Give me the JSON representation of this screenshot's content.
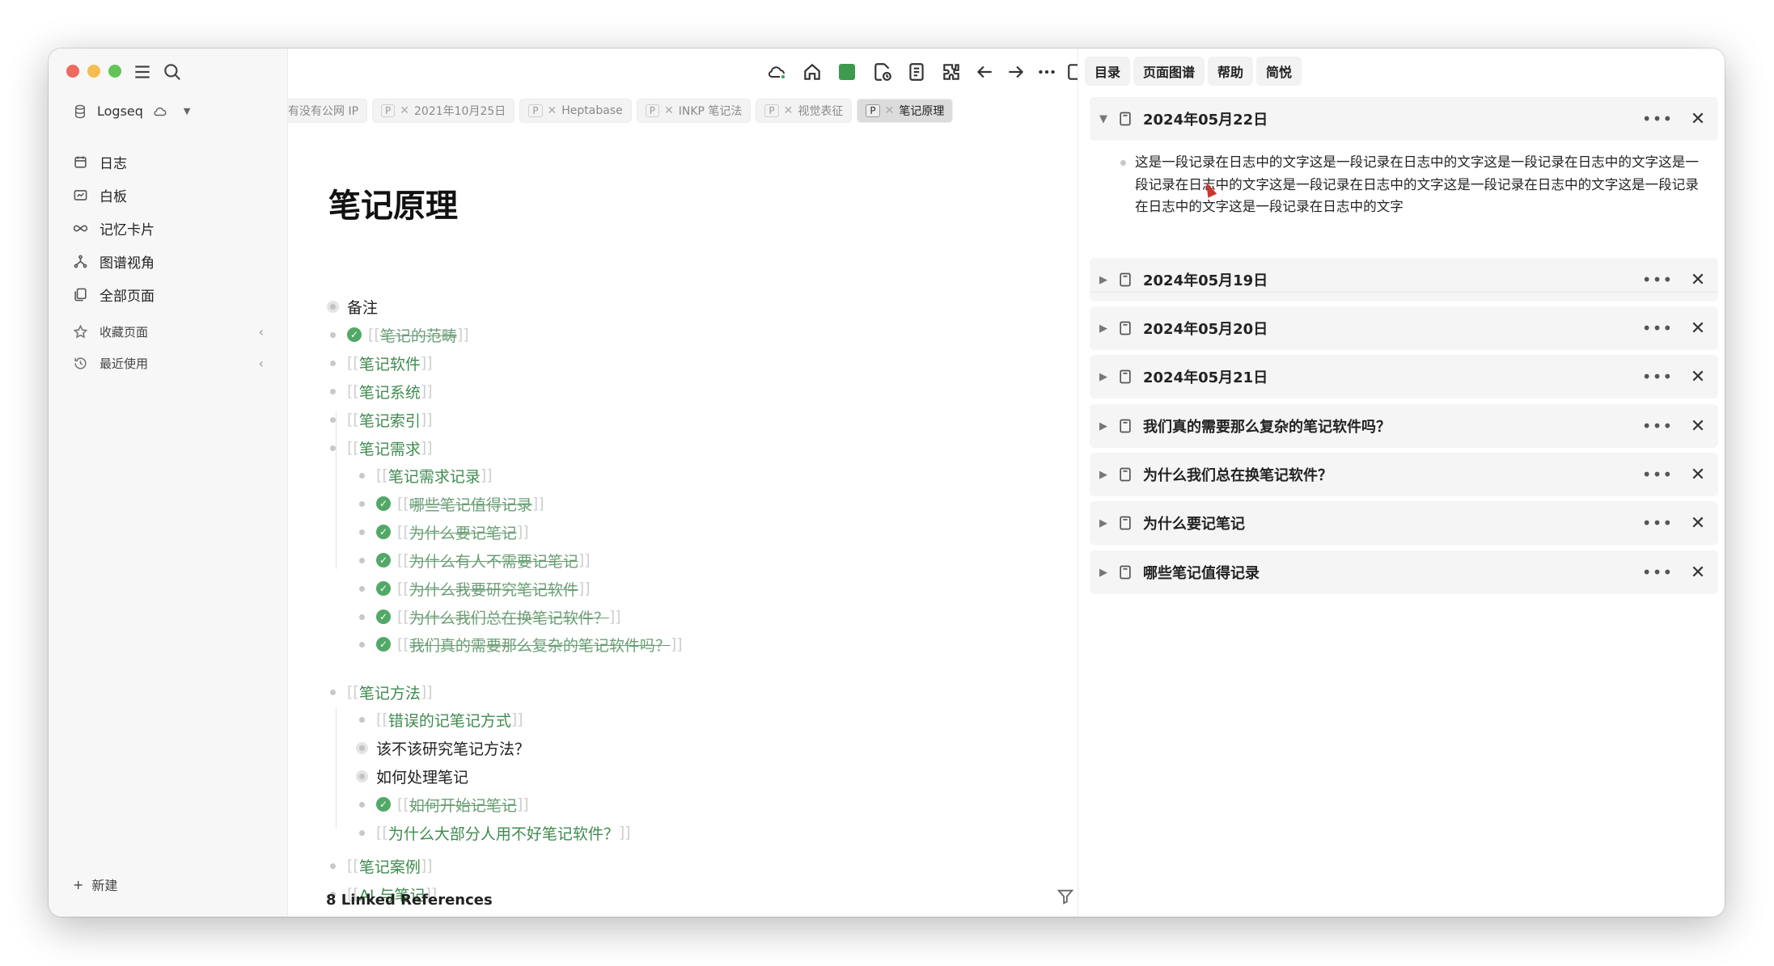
{
  "sidebar": {
    "graph_name": "Logseq",
    "nav": [
      {
        "label": "日志",
        "icon": "calendar-icon"
      },
      {
        "label": "白板",
        "icon": "whiteboard-icon"
      },
      {
        "label": "记忆卡片",
        "icon": "infinity-icon"
      },
      {
        "label": "图谱视角",
        "icon": "graph-icon"
      },
      {
        "label": "全部页面",
        "icon": "pages-icon"
      }
    ],
    "favorites_label": "收藏页面",
    "recent_label": "最近使用",
    "new_label": "新建"
  },
  "tabs": [
    {
      "label": "有没有公网 IP",
      "active": false
    },
    {
      "label": "2021年10月25日",
      "active": false
    },
    {
      "label": "Heptabase",
      "active": false
    },
    {
      "label": "INKP 笔记法",
      "active": false
    },
    {
      "label": "视觉表征",
      "active": false
    },
    {
      "label": "笔记原理",
      "active": true
    }
  ],
  "tab_badge": "P",
  "page": {
    "title": "笔记原理",
    "blocks": [
      {
        "text": "备注",
        "style": "plain",
        "level": 0,
        "bullet": "ring"
      },
      {
        "text": "笔记的范畴",
        "style": "done",
        "level": 0,
        "bullet": "dot"
      },
      {
        "text": "笔记软件",
        "style": "link",
        "level": 0,
        "bullet": "dot"
      },
      {
        "text": "笔记系统",
        "style": "link",
        "level": 0,
        "bullet": "dot"
      },
      {
        "text": "笔记索引",
        "style": "link",
        "level": 0,
        "bullet": "dot"
      },
      {
        "text": "笔记需求",
        "style": "link",
        "level": 0,
        "bullet": "dot"
      },
      {
        "text": "笔记需求记录",
        "style": "link",
        "level": 1,
        "bullet": "dot"
      },
      {
        "text": "哪些笔记值得记录",
        "style": "done",
        "level": 1,
        "bullet": "dot"
      },
      {
        "text": "为什么要记笔记",
        "style": "done",
        "level": 1,
        "bullet": "dot"
      },
      {
        "text": "为什么有人不需要记笔记",
        "style": "done",
        "level": 1,
        "bullet": "dot"
      },
      {
        "text": "为什么我要研究笔记软件",
        "style": "done",
        "level": 1,
        "bullet": "dot"
      },
      {
        "text": "为什么我们总在换笔记软件？",
        "style": "done",
        "level": 1,
        "bullet": "dot"
      },
      {
        "text": "我们真的需要那么复杂的笔记软件吗？",
        "style": "done",
        "level": 1,
        "bullet": "dot"
      },
      {
        "text": "笔记方法",
        "style": "link",
        "level": 0,
        "bullet": "dot"
      },
      {
        "text": "错误的记笔记方式",
        "style": "link",
        "level": 1,
        "bullet": "dot"
      },
      {
        "text": "该不该研究笔记方法？",
        "style": "plain",
        "level": 1,
        "bullet": "ring"
      },
      {
        "text": "如何处理笔记",
        "style": "plain",
        "level": 1,
        "bullet": "ring"
      },
      {
        "text": "如何开始记笔记",
        "style": "done",
        "level": 1,
        "bullet": "dot"
      },
      {
        "text": "为什么大部分人用不好笔记软件？ ",
        "style": "link",
        "level": 1,
        "bullet": "dot"
      },
      {
        "text": "笔记案例",
        "style": "link",
        "level": 0,
        "bullet": "dot"
      },
      {
        "text": "AI 与笔记",
        "style": "link",
        "level": 0,
        "bullet": "dot"
      }
    ],
    "linked_references": "8 Linked References"
  },
  "right_sidebar": {
    "tabs": [
      "目录",
      "页面图谱",
      "帮助",
      "简悦"
    ],
    "cards": [
      {
        "title": "2024年05月22日",
        "expanded": true
      },
      {
        "title": "2024年05月19日",
        "expanded": false
      },
      {
        "title": "2024年05月20日",
        "expanded": false
      },
      {
        "title": "2024年05月21日",
        "expanded": false
      },
      {
        "title": "我们真的需要那么复杂的笔记软件吗？",
        "expanded": false
      },
      {
        "title": "为什么我们总在换笔记软件？",
        "expanded": false
      },
      {
        "title": "为什么要记笔记",
        "expanded": false
      },
      {
        "title": "哪些笔记值得记录",
        "expanded": false
      }
    ],
    "expanded_text": "这是一段记录在日志中的文字这是一段记录在日志中的文字这是一段记录在日志中的文字这是一段记录在日志中的文字这是一段记录在日志中的文字这是一段记录在日志中的文字这是一段记录在日志中的文字这是一段记录在日志中的文字"
  },
  "colors": {
    "link": "#3f8b4f",
    "done_check": "#52a967",
    "sync_square": "#3d9a4f"
  }
}
